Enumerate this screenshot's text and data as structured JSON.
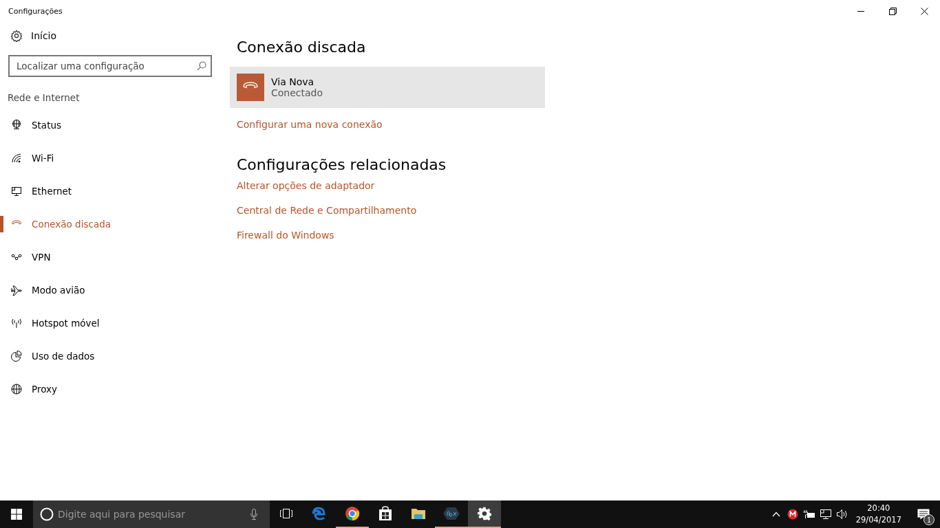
{
  "window": {
    "title": "Configurações"
  },
  "sidebar": {
    "home": "Início",
    "search": {
      "placeholder": "Localizar uma configuração"
    },
    "section": "Rede e Internet",
    "items": [
      {
        "label": "Status",
        "selected": false
      },
      {
        "label": "Wi-Fi",
        "selected": false
      },
      {
        "label": "Ethernet",
        "selected": false
      },
      {
        "label": "Conexão discada",
        "selected": true
      },
      {
        "label": "VPN",
        "selected": false
      },
      {
        "label": "Modo avião",
        "selected": false
      },
      {
        "label": "Hotspot móvel",
        "selected": false
      },
      {
        "label": "Uso de dados",
        "selected": false
      },
      {
        "label": "Proxy",
        "selected": false
      }
    ]
  },
  "main": {
    "title": "Conexão discada",
    "connections": [
      {
        "name": "Via Nova",
        "status": "Conectado",
        "selected": true
      }
    ],
    "setup_link": "Configurar uma nova conexão",
    "related_title": "Configurações relacionadas",
    "related_links": [
      "Alterar opções de adaptador",
      "Central de Rede e Compartilhamento",
      "Firewall do Windows"
    ]
  },
  "taskbar": {
    "search": {
      "placeholder": "Digite aqui para pesquisar"
    },
    "apps": [
      {
        "running": false,
        "selected": false
      },
      {
        "running": false,
        "selected": false
      },
      {
        "running": true,
        "selected": false
      },
      {
        "running": false,
        "selected": false
      },
      {
        "running": false,
        "selected": false
      },
      {
        "running": true,
        "selected": false
      },
      {
        "running": true,
        "selected": true
      }
    ],
    "time": "20:40",
    "date": "29/04/2017",
    "notifications": "1"
  }
}
